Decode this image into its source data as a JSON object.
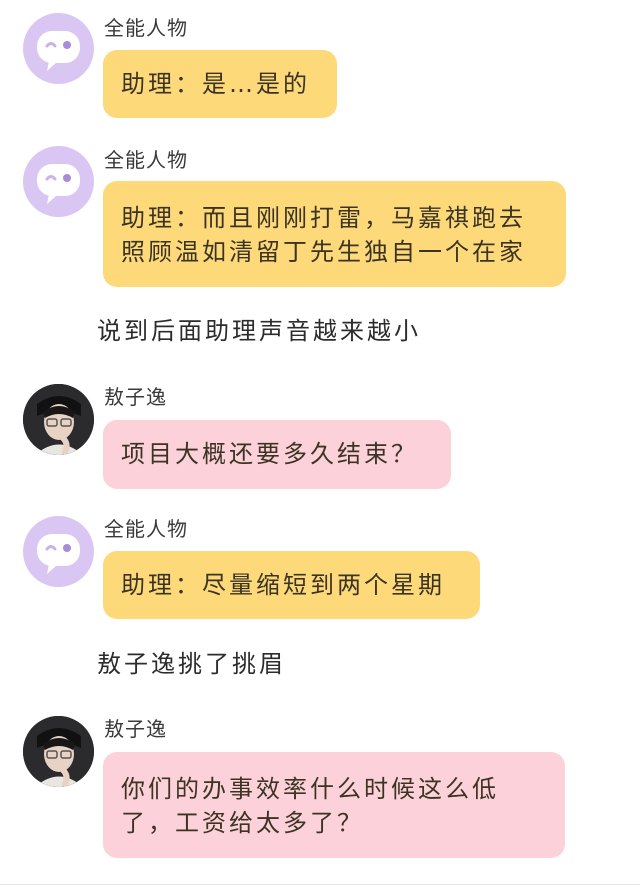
{
  "messages": [
    {
      "sender": "全能人物",
      "avatar_icon": "chat-bubble-face-icon",
      "bubble_color": "#fdd97a",
      "lines": [
        "助理：是…是的"
      ]
    },
    {
      "sender": "全能人物",
      "avatar_icon": "chat-bubble-face-icon",
      "bubble_color": "#fdd97a",
      "lines": [
        "助理：而且刚刚打雷，马嘉祺跑去",
        "照顾温如清留丁先生独自一个在家"
      ]
    },
    {
      "sender": "敖子逸",
      "avatar_icon": "profile-photo",
      "bubble_color": "#fcd1d9",
      "lines": [
        "项目大概还要多久结束？"
      ]
    },
    {
      "sender": "全能人物",
      "avatar_icon": "chat-bubble-face-icon",
      "bubble_color": "#fdd97a",
      "lines": [
        "助理：尽量缩短到两个星期"
      ]
    },
    {
      "sender": "敖子逸",
      "avatar_icon": "profile-photo",
      "bubble_color": "#fcd1d9",
      "lines": [
        "你们的办事效率什么时候这么低",
        "了，工资给太多了？"
      ]
    }
  ],
  "narrations": [
    "说到后面助理声音越来越小",
    "敖子逸挑了挑眉"
  ],
  "colors": {
    "bot_avatar_bg": "#d9c6f2",
    "yellow_bubble": "#fdd97a",
    "pink_bubble": "#fcd1d9"
  }
}
